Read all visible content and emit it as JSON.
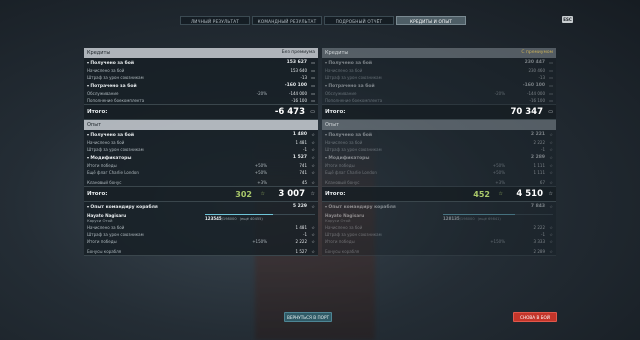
{
  "tabs": [
    "ЛИЧНЫЙ РЕЗУЛЬТАТ",
    "КОМАНДНЫЙ РЕЗУЛЬТАТ",
    "ПОДРОБНЫЙ ОТЧЁТ",
    "КРЕДИТЫ И ОПЫТ"
  ],
  "active_tab": 3,
  "close_label": "ESC",
  "left": {
    "credits_title": "Кредиты",
    "credits_tag": "Без премиума",
    "income": {
      "label": "Получено за бой",
      "value": "153 627"
    },
    "income_rows": [
      {
        "label": "Начислено за бой",
        "value": "153 640"
      },
      {
        "label": "Штраф за урон союзникам",
        "value": "-13"
      }
    ],
    "expense": {
      "label": "Потрачено за бой",
      "value": "-160 100"
    },
    "expense_rows": [
      {
        "label": "Обслуживание",
        "pct": "-20%",
        "value": "-144 000"
      },
      {
        "label": "Пополнение боекомплекта",
        "pct": "",
        "value": "-16 100"
      }
    ],
    "credits_total_label": "Итого:",
    "credits_total": "-6 473",
    "xp_title": "Опыт",
    "xp_income": {
      "label": "Получено за бой",
      "value": "1 480"
    },
    "xp_income_rows": [
      {
        "label": "Начислено за бой",
        "value": "1 481"
      },
      {
        "label": "Штраф за урон союзникам",
        "value": "-1"
      }
    ],
    "mods": {
      "label": "Модификаторы",
      "value": "1 527"
    },
    "mods_rows": [
      {
        "label": "Итоги победы",
        "pct": "+50%",
        "value": "741"
      },
      {
        "label": "Ещё флаг Charlie London",
        "pct": "+50%",
        "value": "741"
      },
      {
        "label": "",
        "pct": "",
        "value": ""
      },
      {
        "label": "Клановый бонус",
        "pct": "+3%",
        "value": "45"
      }
    ],
    "xp_total_label": "Итого:",
    "xp_total_green": "302",
    "xp_total": "3 007",
    "cmdr": {
      "label": "Опыт командиру корабля",
      "value": "5 229"
    },
    "cmdr_name": "Hayato Nagisaru",
    "cmdr_ship": "Каруси Отой",
    "cmdr_xp": "123545",
    "cmdr_xp_max": "/198000",
    "cmdr_xp_note": "(ещё 40455)",
    "cmdr_progress": 0.62,
    "cmdr_rows": [
      {
        "label": "Начислено за бой",
        "pct": "",
        "value": "1 481"
      },
      {
        "label": "Штраф за урон союзникам",
        "pct": "",
        "value": "-1"
      },
      {
        "label": "Итоги победы",
        "pct": "+150%",
        "value": "2 222"
      },
      {
        "label": "",
        "pct": "",
        "value": ""
      },
      {
        "label": "Бонусы корабля",
        "pct": "",
        "value": "1 527"
      }
    ]
  },
  "right": {
    "credits_title": "Кредиты",
    "credits_tag": "С премиумом",
    "income": {
      "label": "Получено за бой",
      "value": "230 447"
    },
    "income_rows": [
      {
        "label": "Начислено за бой",
        "value": "230 460"
      },
      {
        "label": "Штраф за урон союзникам",
        "value": "-13"
      }
    ],
    "expense": {
      "label": "Потрачено за бой",
      "value": "-160 100"
    },
    "expense_rows": [
      {
        "label": "Обслуживание",
        "pct": "-20%",
        "value": "-144 000"
      },
      {
        "label": "Пополнение боекомплекта",
        "pct": "",
        "value": "-16 100"
      }
    ],
    "credits_total_label": "Итого:",
    "credits_total": "70 347",
    "xp_title": "Опыт",
    "xp_income": {
      "label": "Получено за бой",
      "value": "2 221"
    },
    "xp_income_rows": [
      {
        "label": "Начислено за бой",
        "value": "2 222"
      },
      {
        "label": "Штраф за урон союзникам",
        "value": "-1"
      }
    ],
    "mods": {
      "label": "Модификаторы",
      "value": "2 289"
    },
    "mods_rows": [
      {
        "label": "Итоги победы",
        "pct": "+50%",
        "value": "1 111"
      },
      {
        "label": "Ещё флаг Charlie London",
        "pct": "+50%",
        "value": "1 111"
      },
      {
        "label": "",
        "pct": "",
        "value": ""
      },
      {
        "label": "Клановый бонус",
        "pct": "+3%",
        "value": "67"
      }
    ],
    "xp_total_label": "Итого:",
    "xp_total_green": "452",
    "xp_total": "4 510",
    "cmdr": {
      "label": "Опыт командиру корабля",
      "value": "7 843"
    },
    "cmdr_name": "Hayato Nagisaru",
    "cmdr_ship": "Каруси Отой",
    "cmdr_xp": "128135",
    "cmdr_xp_max": "/198000",
    "cmdr_xp_note": "(ещё 69841)",
    "cmdr_progress": 0.65,
    "cmdr_rows": [
      {
        "label": "Начислено за бой",
        "pct": "",
        "value": "2 222"
      },
      {
        "label": "Штраф за урон союзникам",
        "pct": "",
        "value": "-1"
      },
      {
        "label": "Итоги победы",
        "pct": "+150%",
        "value": "3 333"
      },
      {
        "label": "",
        "pct": "",
        "value": ""
      },
      {
        "label": "Бонусы корабля",
        "pct": "",
        "value": "2 289"
      }
    ]
  },
  "buttons": {
    "port": "ВЕРНУТЬСЯ В ПОРТ",
    "battle": "СНОВА В БОЙ"
  }
}
